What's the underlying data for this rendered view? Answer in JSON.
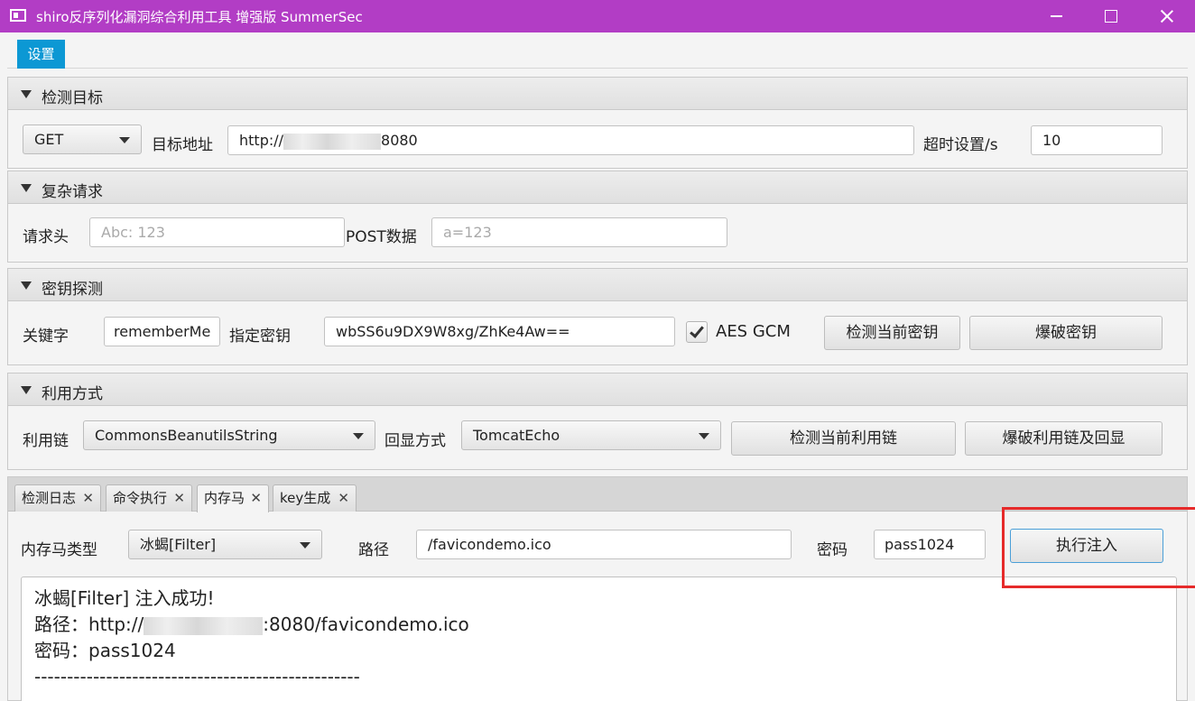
{
  "window": {
    "title": "shiro反序列化漏洞综合利用工具 增强版 SummerSec"
  },
  "menu": {
    "settings": "设置"
  },
  "target": {
    "title": "检测目标",
    "method": "GET",
    "url_label": "目标地址",
    "url_value_prefix": "http://",
    "url_value_suffix": "8080",
    "timeout_label": "超时设置/s",
    "timeout_value": "10"
  },
  "complex": {
    "title": "复杂请求",
    "header_label": "请求头",
    "header_placeholder": "Abc: 123",
    "post_label": "POST数据",
    "post_placeholder": "a=123"
  },
  "key": {
    "title": "密钥探测",
    "keyword_label": "关键字",
    "keyword_value": "rememberMe",
    "key_label": "指定密钥",
    "key_value": "wbSS6u9DX9W8xg/ZhKe4Aw==",
    "aes_gcm_label": "AES GCM",
    "aes_gcm_checked": true,
    "check_button": "检测当前密钥",
    "brute_button": "爆破密钥"
  },
  "exploit": {
    "title": "利用方式",
    "chain_label": "利用链",
    "chain_value": "CommonsBeanutilsString",
    "echo_label": "回显方式",
    "echo_value": "TomcatEcho",
    "check_button": "检测当前利用链",
    "brute_button": "爆破利用链及回显"
  },
  "tabs": [
    {
      "label": "检测日志"
    },
    {
      "label": "命令执行"
    },
    {
      "label": "内存马"
    },
    {
      "label": "key生成"
    }
  ],
  "memshell": {
    "type_label": "内存马类型",
    "type_value": "冰蝎[Filter]",
    "path_label": "路径",
    "path_value": "/favicondemo.ico",
    "password_label": "密码",
    "password_value": "pass1024",
    "inject_button": "执行注入"
  },
  "output": {
    "line1": "冰蝎[Filter]  注入成功!",
    "line2_prefix": "路径：http://",
    "line2_suffix": ":8080/favicondemo.ico",
    "line3": "密码：pass1024",
    "line4": "--------------------------------------------------"
  },
  "colors": {
    "titlebar": "#b23dc5",
    "settings_tab": "#0c98d4",
    "highlight_box": "#e62a2a"
  }
}
